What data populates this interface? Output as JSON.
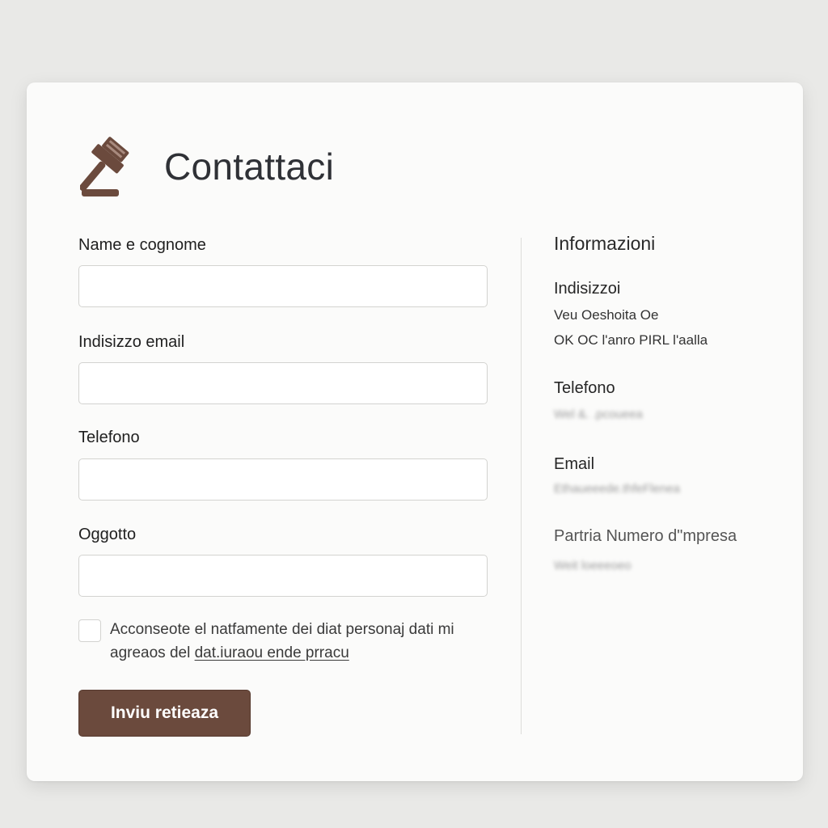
{
  "header": {
    "title": "Contattaci",
    "logo_icon": "gavel-icon"
  },
  "form": {
    "fields": [
      {
        "label": "Name e cognome",
        "value": "",
        "placeholder": ""
      },
      {
        "label": "Indisizzo email",
        "value": "",
        "placeholder": ""
      },
      {
        "label": "Telefono",
        "value": "",
        "placeholder": ""
      },
      {
        "label": "Oggotto",
        "value": "",
        "placeholder": ""
      }
    ],
    "consent": {
      "text": "Acconseote el natfamente dei diat personaj dati mi agreaos del ",
      "link": "dat.iurao​u ende prracu",
      "checked": false
    },
    "submit_label": "Inviu retieaza"
  },
  "info": {
    "title": "Informazioni",
    "address_label": "Indisizzoi",
    "address_line1": "Veu Oeshoita Oe",
    "address_line2": "OK OC l'anro PIRL l'aalla",
    "phone_label": "Telefono",
    "phone_value": "Wel &. .pcoueea",
    "email_label": "Email",
    "email_value": "Ethaueeede.thfeFlenea",
    "vat_label": "Partria Numero d\"mpresa",
    "vat_value": "Weit loeeeoeo"
  },
  "colors": {
    "accent": "#6b4a3d",
    "background": "#e9e9e7",
    "card": "#fbfbfa",
    "border": "#d3d3d0"
  }
}
